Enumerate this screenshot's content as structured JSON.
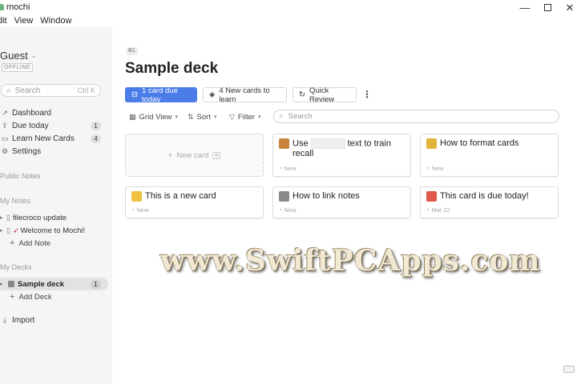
{
  "window": {
    "title": "mochi",
    "minimize": "—",
    "close": "✕"
  },
  "menu": [
    "dit",
    "View",
    "Window"
  ],
  "sidebar": {
    "user": "Guest",
    "status": "OFFLINE",
    "search": {
      "placeholder": "Search",
      "shortcut": "Ctrl K"
    },
    "nav": [
      {
        "label": "Dashboard",
        "icon": "trend-icon"
      },
      {
        "label": "Due today",
        "icon": "upload-icon",
        "count": "1"
      },
      {
        "label": "Learn New Cards",
        "icon": "card-icon",
        "count": "4"
      },
      {
        "label": "Settings",
        "icon": "gear-icon"
      }
    ],
    "sections": {
      "public_notes": "Public Notes",
      "my_notes": "My Notes",
      "my_decks": "My Decks"
    },
    "notes": [
      {
        "label": "filecroco update"
      },
      {
        "label": "Welcome to Mochi!"
      }
    ],
    "add_note": "Add Note",
    "decks": [
      {
        "label": "Sample deck",
        "count": "1"
      }
    ],
    "add_deck": "Add Deck",
    "import": "Import"
  },
  "main": {
    "badge": "1",
    "title": "Sample deck",
    "buttons": {
      "due": "1 card due today",
      "learn": "4 New cards to learn",
      "quick": "Quick Review"
    },
    "toolbar": {
      "view": "Grid View",
      "sort": "Sort",
      "filter": "Filter",
      "search_placeholder": "Search"
    },
    "new_card": {
      "label": "New card",
      "shortcut": "n"
    },
    "cards": [
      {
        "title_pre": "Use",
        "title_post": "text to train recall",
        "meta": "New",
        "emoji_color": "#c8843a"
      },
      {
        "title": "How to format cards",
        "meta": "New",
        "emoji_color": "#e0b43a"
      },
      {
        "title": "This is a new card",
        "meta": "New",
        "emoji_color": "#f0c040"
      },
      {
        "title": "How to link notes",
        "meta": "New",
        "emoji_color": "#888888"
      },
      {
        "title": "This card is due today!",
        "meta": "Mar 22",
        "emoji_color": "#e05a4a"
      }
    ]
  },
  "watermark": "www.SwiftPCApps.com",
  "colors": {
    "accent": "#4a7de8",
    "sidebar_bg": "#f5f5f5"
  }
}
